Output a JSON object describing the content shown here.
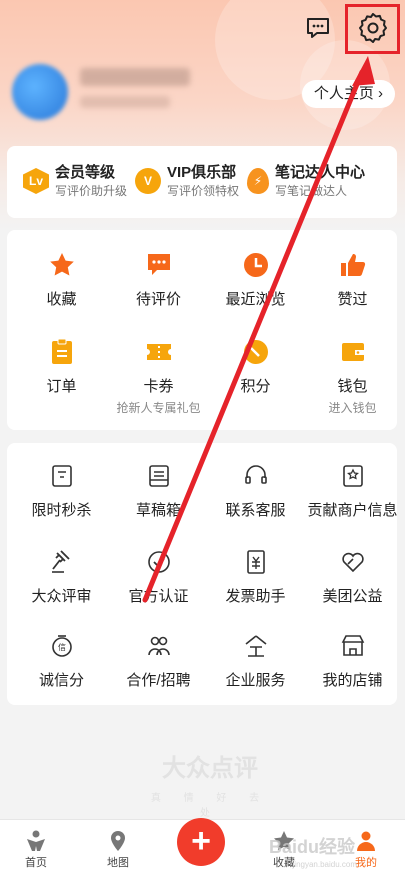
{
  "header": {
    "profile_button": "个人主页",
    "profile_chevron": "›"
  },
  "member_bar": [
    {
      "badge": "Lv",
      "title": "会员等级",
      "sub": "写评价助升级",
      "color": "#f6a50c"
    },
    {
      "badge": "V",
      "title": "VIP俱乐部",
      "sub": "写评价领特权",
      "color": "#f6a50c"
    },
    {
      "badge": "⚡",
      "title": "笔记达人中心",
      "sub": "写笔记做达人",
      "color": "#f7931e"
    }
  ],
  "grid_primary": [
    {
      "label": "收藏",
      "sub": "",
      "icon": "star-icon"
    },
    {
      "label": "待评价",
      "sub": "",
      "icon": "comment-icon"
    },
    {
      "label": "最近浏览",
      "sub": "",
      "icon": "clock-icon"
    },
    {
      "label": "赞过",
      "sub": "",
      "icon": "thumbs-up-icon"
    },
    {
      "label": "订单",
      "sub": "",
      "icon": "clipboard-icon"
    },
    {
      "label": "卡券",
      "sub": "抢新人专属礼包",
      "icon": "ticket-icon"
    },
    {
      "label": "积分",
      "sub": "",
      "icon": "points-icon"
    },
    {
      "label": "钱包",
      "sub": "进入钱包",
      "icon": "wallet-icon"
    }
  ],
  "grid_secondary": [
    {
      "label": "限时秒杀",
      "icon": "flash-sale-icon"
    },
    {
      "label": "草稿箱",
      "icon": "drafts-icon"
    },
    {
      "label": "联系客服",
      "icon": "headset-icon"
    },
    {
      "label": "贡献商户信息",
      "icon": "merchant-info-icon"
    },
    {
      "label": "大众评审",
      "icon": "gavel-icon"
    },
    {
      "label": "官方认证",
      "icon": "verified-icon"
    },
    {
      "label": "发票助手",
      "icon": "invoice-icon"
    },
    {
      "label": "美团公益",
      "icon": "charity-icon"
    },
    {
      "label": "诚信分",
      "icon": "credit-score-icon"
    },
    {
      "label": "合作/招聘",
      "icon": "partners-icon"
    },
    {
      "label": "企业服务",
      "icon": "enterprise-icon"
    },
    {
      "label": "我的店铺",
      "icon": "store-icon"
    }
  ],
  "watermark": {
    "logo": "大众点评",
    "sub": "真 情 好 去 处"
  },
  "tabbar": [
    {
      "label": "首页",
      "icon": "home-icon"
    },
    {
      "label": "地图",
      "icon": "map-icon"
    },
    {
      "label": "+",
      "icon": "plus-icon"
    },
    {
      "label": "收藏",
      "icon": "star-icon"
    },
    {
      "label": "我的",
      "icon": "profile-icon"
    }
  ],
  "baidu_watermark": {
    "logo": "Baidu经验",
    "sub": "jingyan.baidu.com"
  },
  "colors": {
    "accent": "#f6681a",
    "highlight": "#e5232a",
    "plus": "#f13c2b"
  }
}
